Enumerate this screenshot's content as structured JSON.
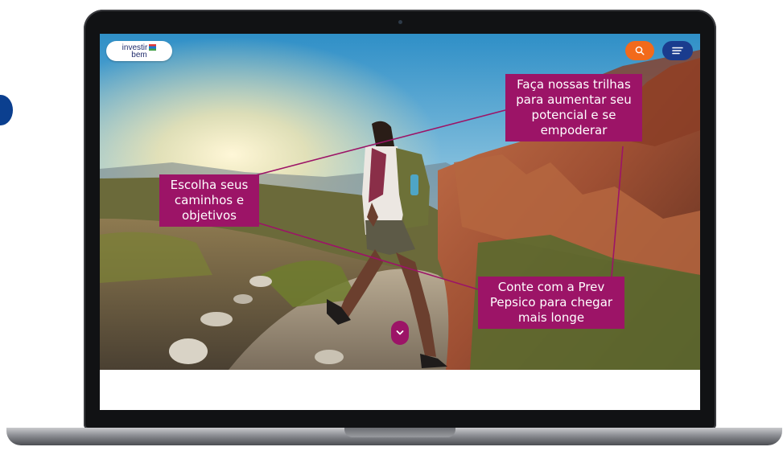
{
  "logo": {
    "line1": "investir",
    "line2": "bem"
  },
  "header": {
    "search_icon": "search-icon",
    "menu_icon": "menu-icon"
  },
  "colors": {
    "accent": "#9c1467",
    "search_button": "#f26a1b",
    "menu_button": "#1a3c8e",
    "logo_text": "#222e6e"
  },
  "callouts": [
    {
      "lines": [
        "Faça nossas trilhas",
        "para aumentar seu",
        "potencial e se",
        "empoderar"
      ]
    },
    {
      "lines": [
        "Escolha seus",
        "caminhos e",
        "objetivos"
      ]
    },
    {
      "lines": [
        "Conte com a Prev",
        "Pepsico para chegar",
        "mais longe"
      ]
    }
  ],
  "scroll_icon": "chevron-down-icon"
}
